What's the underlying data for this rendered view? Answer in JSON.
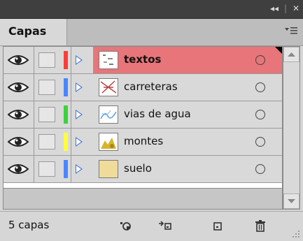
{
  "panel": {
    "tab_label": "Capas",
    "collapse_glyph": "◂◂",
    "separator_glyph": "|",
    "close_glyph": "✕"
  },
  "layers": [
    {
      "name": "textos",
      "color": "#ff3b3b",
      "selected": true
    },
    {
      "name": "carreteras",
      "color": "#4b86ff",
      "selected": false
    },
    {
      "name": "vias de agua",
      "color": "#3cd23c",
      "selected": false
    },
    {
      "name": "montes",
      "color": "#ffff3c",
      "selected": false
    },
    {
      "name": "suelo",
      "color": "#4b86ff",
      "selected": false
    }
  ],
  "footer": {
    "count_label": "5 capas"
  },
  "colors": {
    "selection": "#e7757a",
    "expand_triangle": "#4b77c8"
  }
}
